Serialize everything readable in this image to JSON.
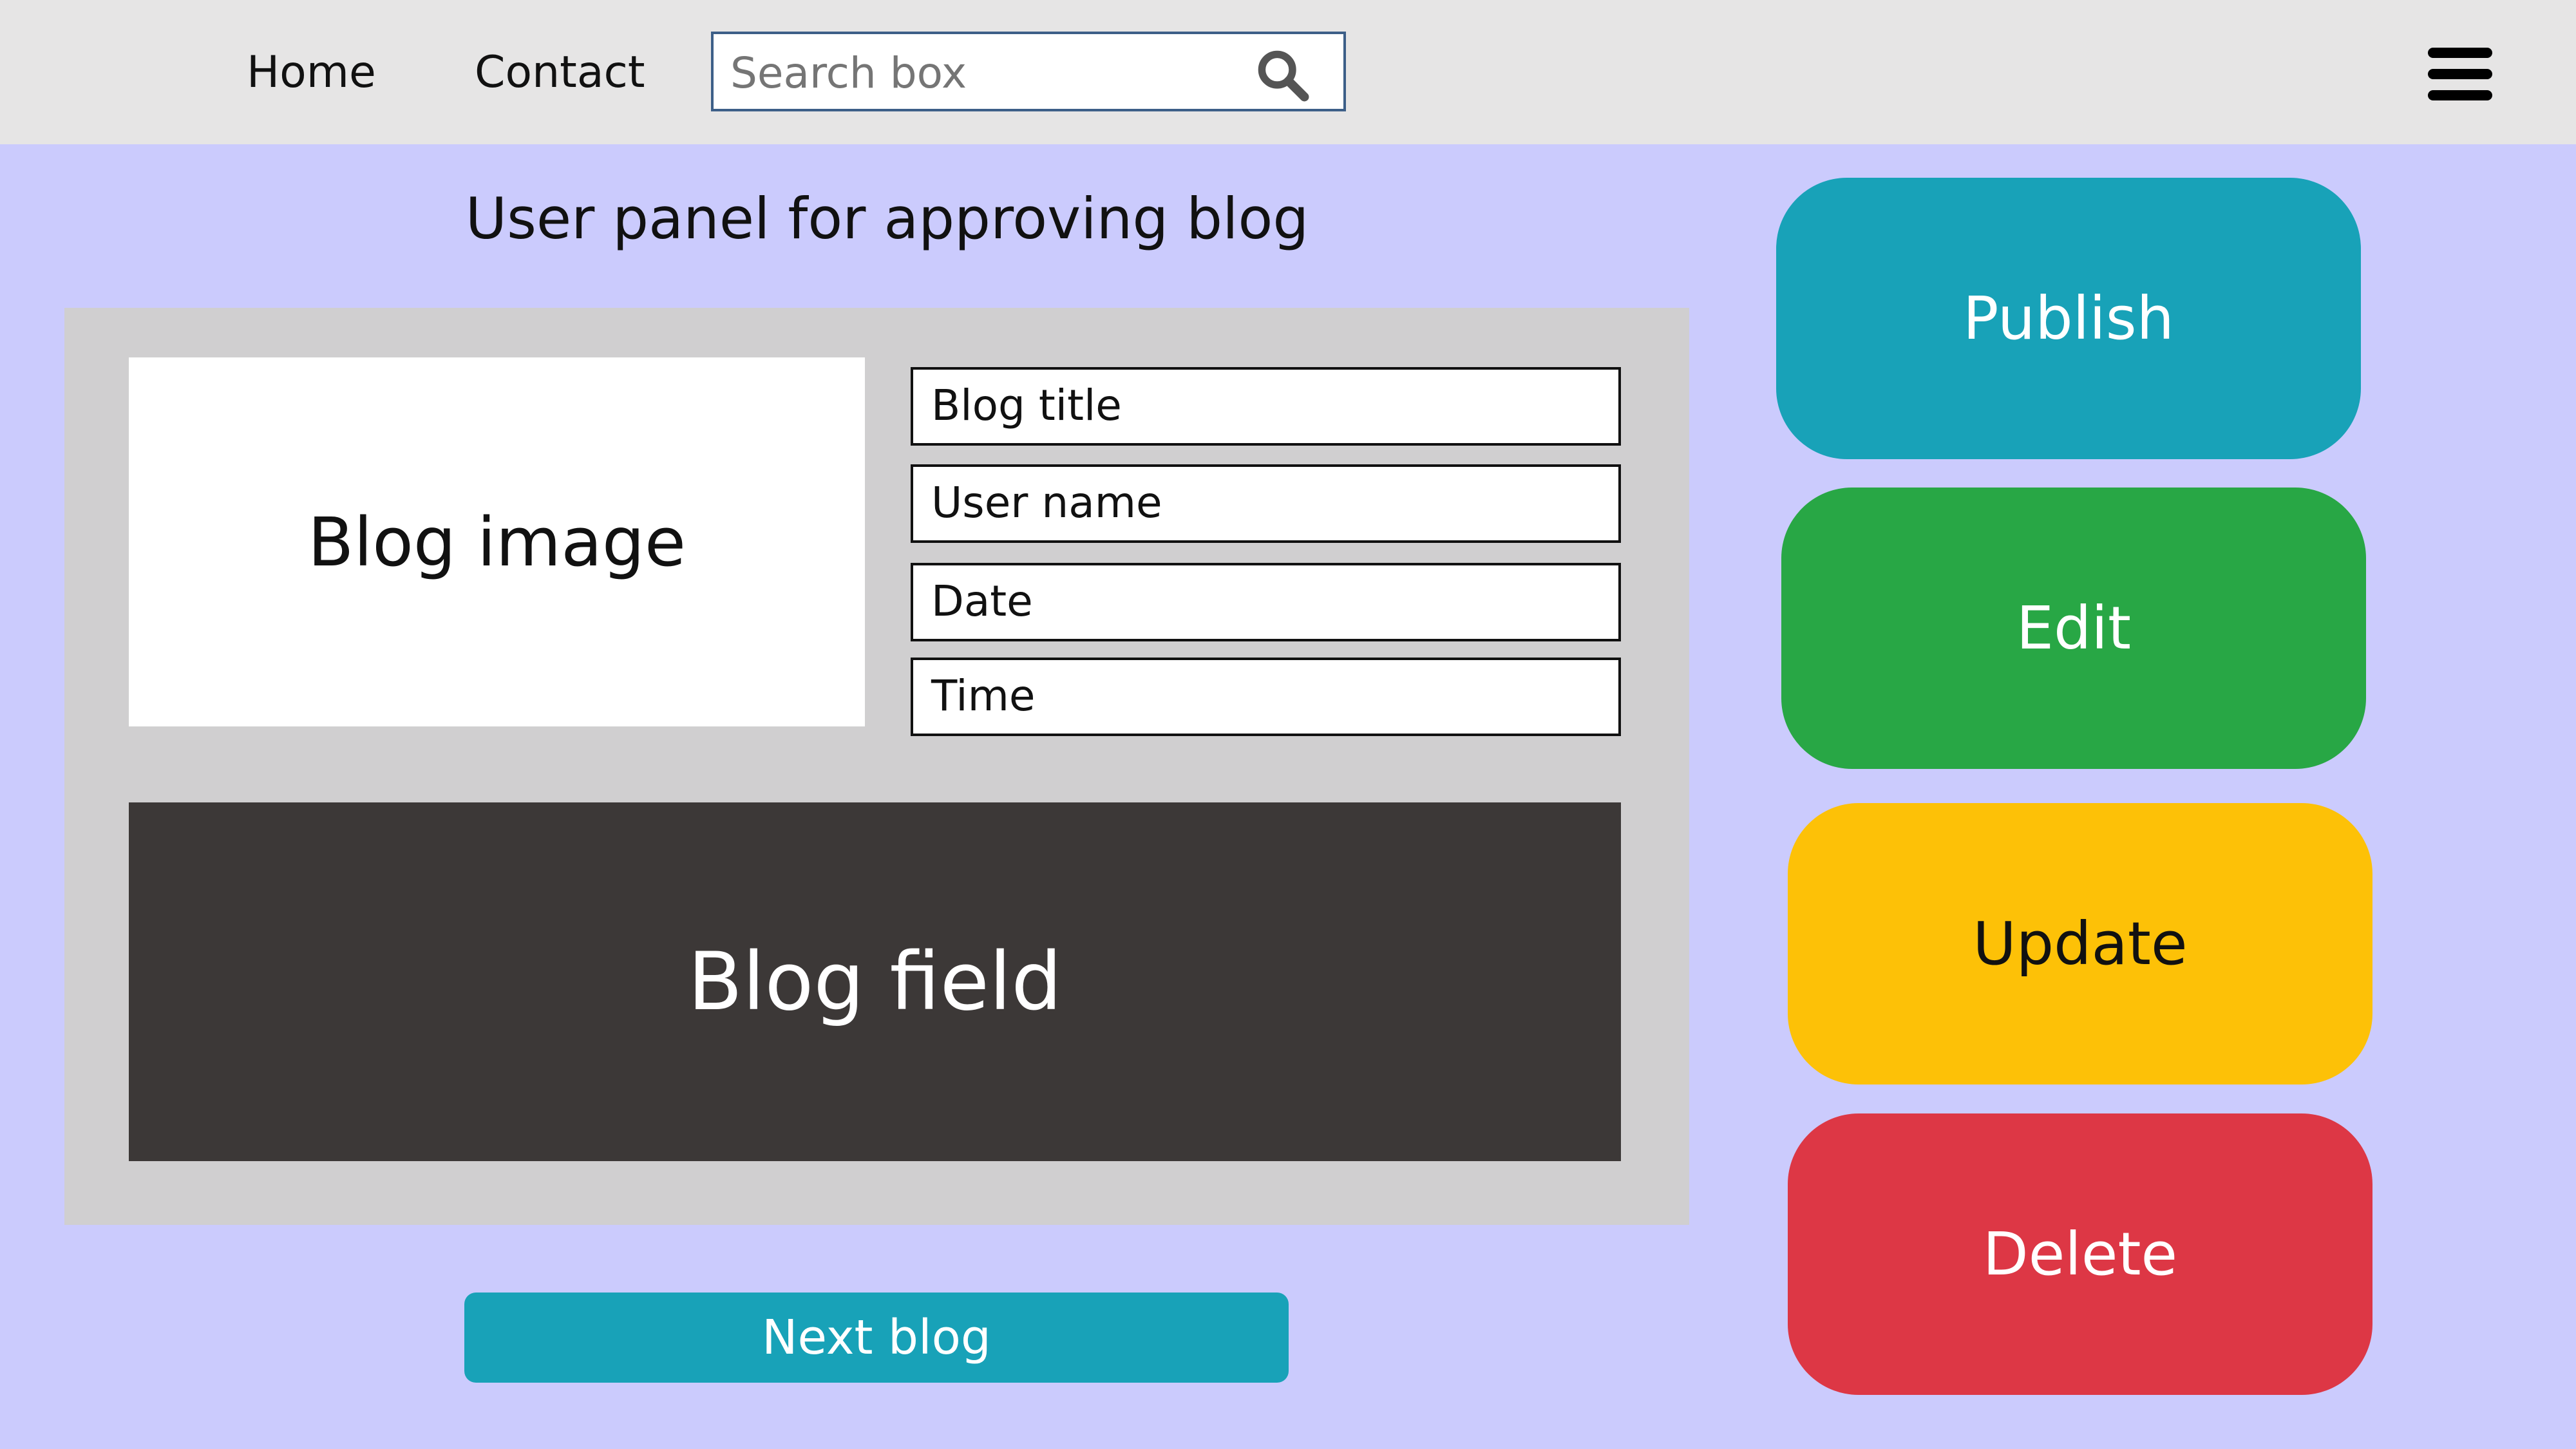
{
  "nav": {
    "home_label": "Home",
    "contact_label": "Contact",
    "search_placeholder": "Search box",
    "search_icon": "search-icon",
    "menu_icon": "hamburger-menu-icon"
  },
  "main": {
    "title": "User panel for approving blog",
    "blog_image_label": "Blog image",
    "fields": {
      "blog_title": "Blog title",
      "user_name": "User name",
      "date": "Date",
      "time": "Time"
    },
    "blog_field_label": "Blog field",
    "next_blog_label": "Next blog"
  },
  "actions": {
    "publish": "Publish",
    "edit": "Edit",
    "update": "Update",
    "delete": "Delete"
  },
  "colors": {
    "page_background": "#cbcbfd",
    "topbar_background": "#e6e5e5",
    "panel_background": "#d0cfd0",
    "blog_field_background": "#3c3837",
    "publish": "#18a2b8",
    "edit": "#28a745",
    "update": "#fdc107",
    "delete": "#dd3745",
    "next_blog": "#18a2b8"
  }
}
